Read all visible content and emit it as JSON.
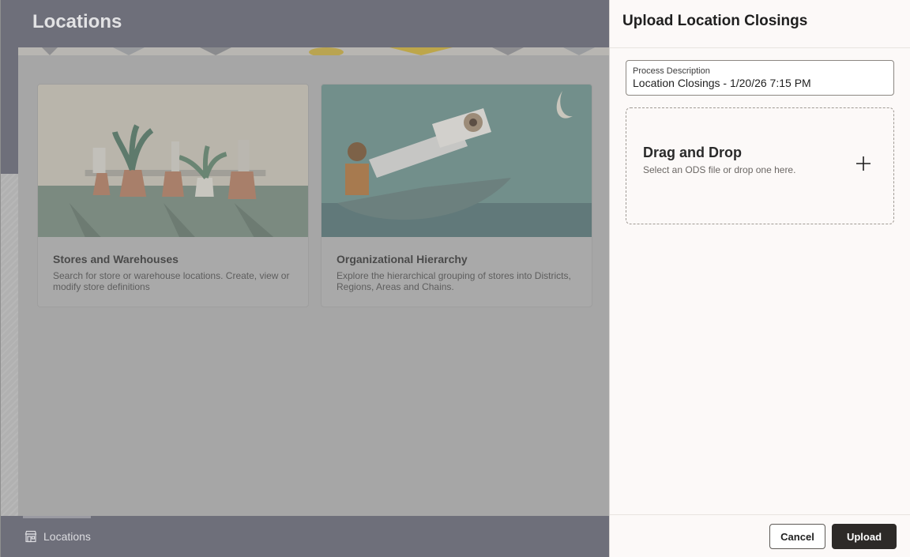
{
  "page": {
    "title": "Locations",
    "cards": [
      {
        "title": "Stores and Warehouses",
        "description": "Search for store or warehouse locations. Create, view or modify store definitions"
      },
      {
        "title": "Organizational Hierarchy",
        "description": "Explore the hierarchical grouping of stores into Districts, Regions, Areas and Chains."
      }
    ],
    "footer": {
      "nav_label": "Locations",
      "nav_icon": "store-icon"
    }
  },
  "drawer": {
    "title": "Upload Location Closings",
    "process_description": {
      "label": "Process Description",
      "value": "Location Closings - 1/20/26 7:15 PM"
    },
    "dropzone": {
      "title": "Drag and Drop",
      "subtitle": "Select an ODS file or drop one here.",
      "icon": "plus-icon"
    },
    "buttons": {
      "cancel": "Cancel",
      "upload": "Upload"
    }
  },
  "colors": {
    "overlay_header": "#6e6f7a",
    "drawer_bg": "#fcf9f8",
    "primary_button": "#2d2a28"
  }
}
